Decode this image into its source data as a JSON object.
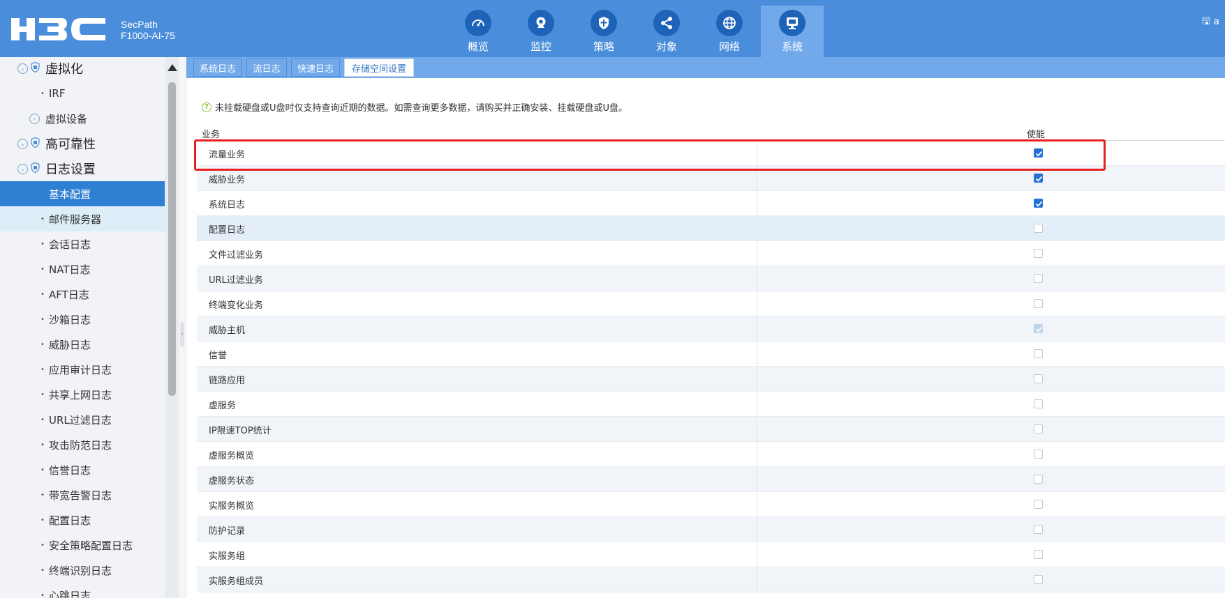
{
  "header": {
    "logo_text": "H3C",
    "product_line1": "SecPath",
    "product_line2": "F1000-AI-75",
    "user_text": "a",
    "nav": [
      {
        "label": "概览",
        "icon": "gauge-icon",
        "active": false
      },
      {
        "label": "监控",
        "icon": "monitor-camera-icon",
        "active": false
      },
      {
        "label": "策略",
        "icon": "shield-icon",
        "active": false
      },
      {
        "label": "对象",
        "icon": "share-nodes-icon",
        "active": false
      },
      {
        "label": "网络",
        "icon": "globe-icon",
        "active": false
      },
      {
        "label": "系统",
        "icon": "desktop-icon",
        "active": true
      }
    ]
  },
  "sidebar": {
    "items": [
      {
        "label": "虚拟化",
        "level": 1,
        "expanded": true
      },
      {
        "label": "IRF",
        "level": 2
      },
      {
        "label": "虚拟设备",
        "level": 1.5,
        "expandable": true
      },
      {
        "label": "高可靠性",
        "level": 1,
        "expanded": true
      },
      {
        "label": "日志设置",
        "level": 1,
        "expanded": true
      },
      {
        "label": "基本配置",
        "level": 2,
        "active": true
      },
      {
        "label": "邮件服务器",
        "level": 2,
        "hover": true
      },
      {
        "label": "会话日志",
        "level": 2
      },
      {
        "label": "NAT日志",
        "level": 2
      },
      {
        "label": "AFT日志",
        "level": 2
      },
      {
        "label": "沙箱日志",
        "level": 2
      },
      {
        "label": "威胁日志",
        "level": 2
      },
      {
        "label": "应用审计日志",
        "level": 2
      },
      {
        "label": "共享上网日志",
        "level": 2
      },
      {
        "label": "URL过滤日志",
        "level": 2
      },
      {
        "label": "攻击防范日志",
        "level": 2
      },
      {
        "label": "信誉日志",
        "level": 2
      },
      {
        "label": "带宽告警日志",
        "level": 2
      },
      {
        "label": "配置日志",
        "level": 2
      },
      {
        "label": "安全策略配置日志",
        "level": 2
      },
      {
        "label": "终端识别日志",
        "level": 2
      },
      {
        "label": "心跳日志",
        "level": 2
      }
    ]
  },
  "tabs": [
    {
      "label": "系统日志",
      "active": false
    },
    {
      "label": "流日志",
      "active": false
    },
    {
      "label": "快速日志",
      "active": false
    },
    {
      "label": "存储空间设置",
      "active": true
    }
  ],
  "notice": "未挂载硬盘或U盘时仅支持查询近期的数据。如需查询更多数据，请购买并正确安装、挂载硬盘或U盘。",
  "table": {
    "col_service": "业务",
    "col_enable": "使能",
    "rows": [
      {
        "name": "流量业务",
        "state": "checked"
      },
      {
        "name": "威胁业务",
        "state": "checked"
      },
      {
        "name": "系统日志",
        "state": "checked"
      },
      {
        "name": "配置日志",
        "state": "unchecked"
      },
      {
        "name": "文件过滤业务",
        "state": "unchecked"
      },
      {
        "name": "URL过滤业务",
        "state": "unchecked"
      },
      {
        "name": "终端变化业务",
        "state": "unchecked"
      },
      {
        "name": "威胁主机",
        "state": "checked-disabled"
      },
      {
        "name": "信誉",
        "state": "unchecked"
      },
      {
        "name": "链路应用",
        "state": "unchecked"
      },
      {
        "name": "虚服务",
        "state": "unchecked"
      },
      {
        "name": "IP限速TOP统计",
        "state": "unchecked"
      },
      {
        "name": "虚服务概览",
        "state": "unchecked"
      },
      {
        "name": "虚服务状态",
        "state": "unchecked"
      },
      {
        "name": "实服务概览",
        "state": "unchecked"
      },
      {
        "name": "防护记录",
        "state": "unchecked"
      },
      {
        "name": "实服务组",
        "state": "unchecked"
      },
      {
        "name": "实服务组成员",
        "state": "unchecked"
      }
    ]
  },
  "colors": {
    "header_bg": "#4a8edb",
    "active_nav_bg": "#72a9ea",
    "sidebar_active": "#2f7fd3",
    "checkbox_checked": "#2470d6",
    "highlight_border": "#e62020"
  }
}
